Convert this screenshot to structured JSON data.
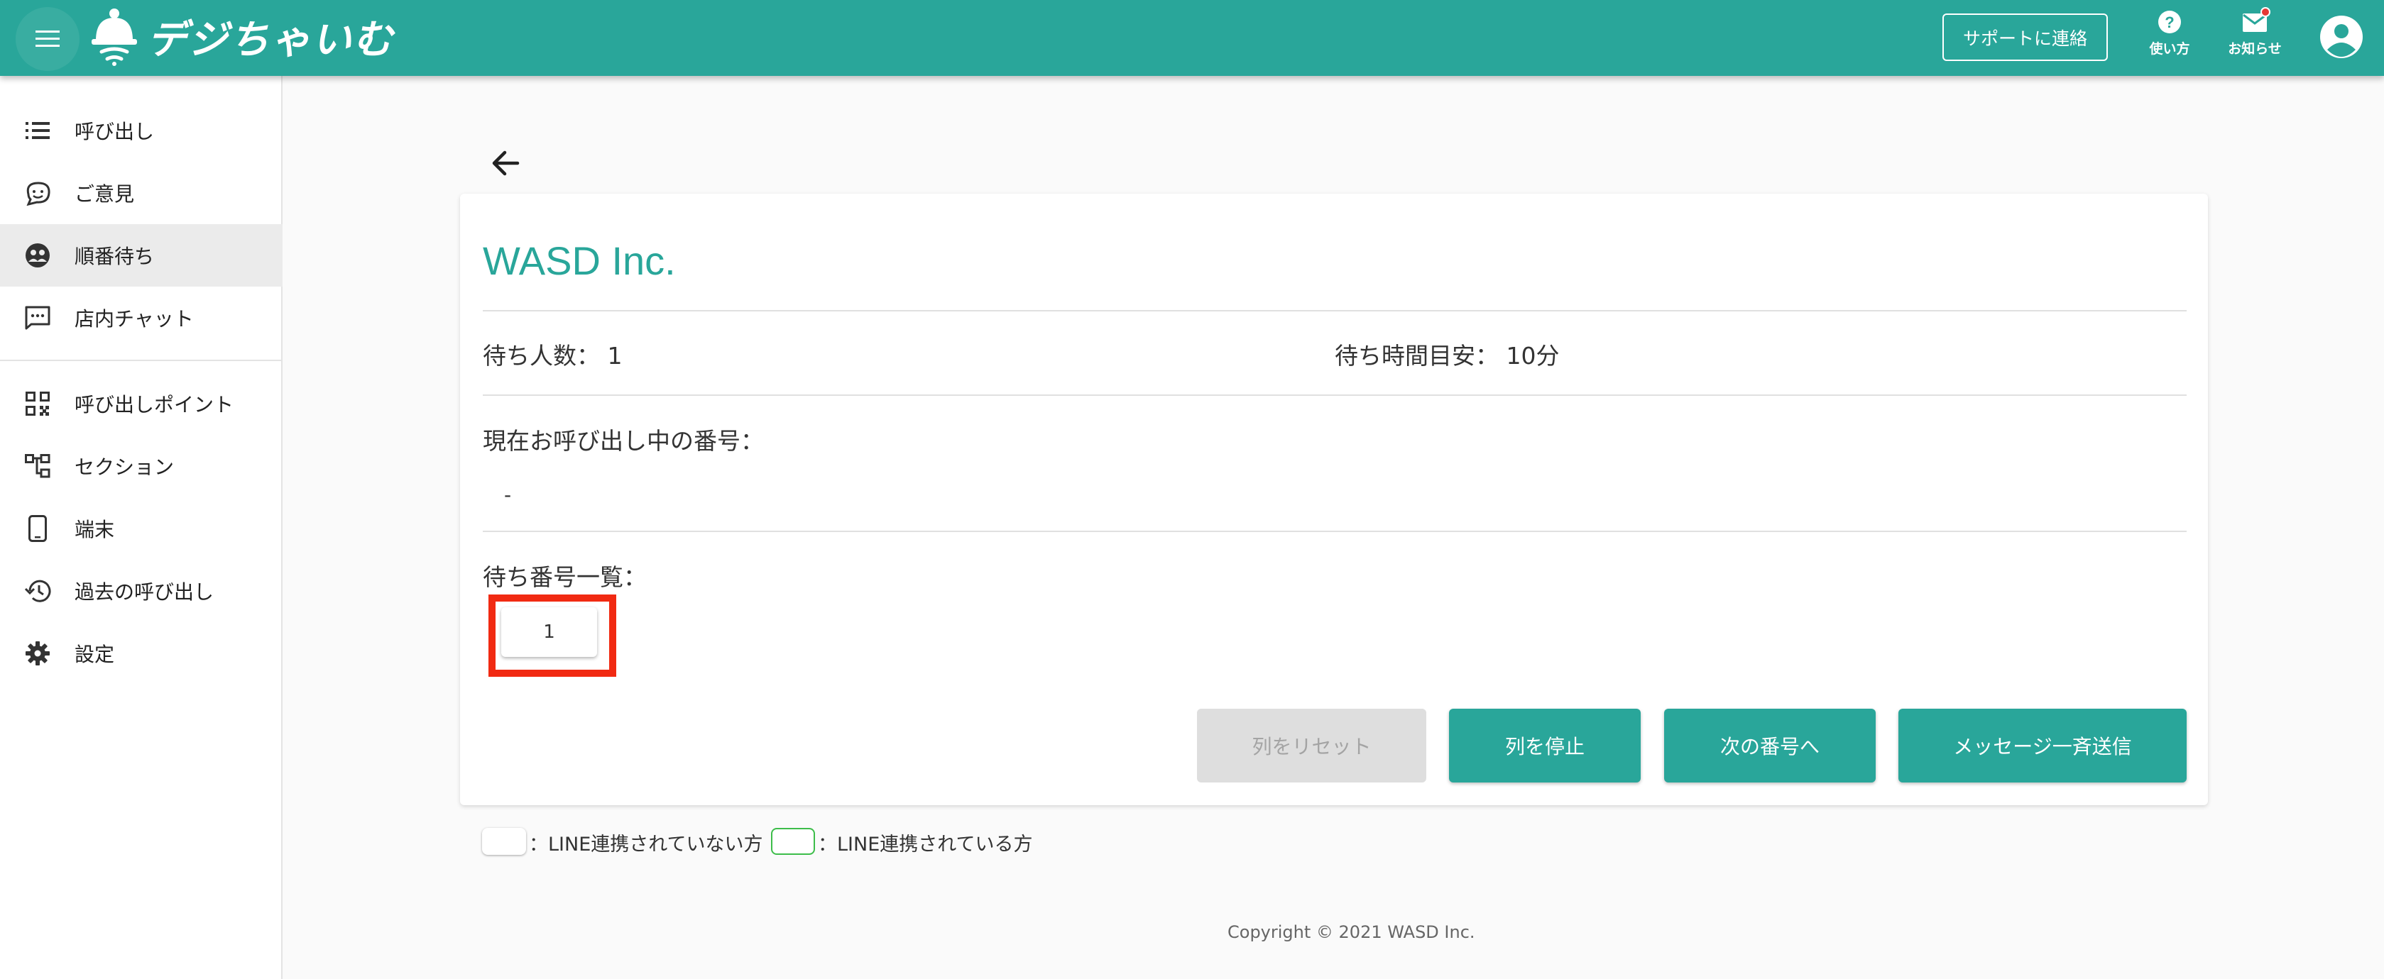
{
  "header": {
    "app_name": "デジちゃいむ",
    "support_label": "サポートに連絡",
    "help_label": "使い方",
    "notice_label": "お知らせ",
    "icons": [
      "menu-icon",
      "bell-logo-icon",
      "help-icon",
      "mail-icon",
      "account-icon"
    ],
    "color": "#29a69a"
  },
  "sidebar": {
    "items": [
      {
        "label": "呼び出し",
        "icon": "list-icon"
      },
      {
        "label": "ご意見",
        "icon": "feedback-icon"
      },
      {
        "label": "順番待ち",
        "icon": "queue-icon",
        "active": true
      },
      {
        "label": "店内チャット",
        "icon": "chat-icon"
      },
      {
        "label": "呼び出しポイント",
        "icon": "qr-code-icon"
      },
      {
        "label": "セクション",
        "icon": "section-icon"
      },
      {
        "label": "端末",
        "icon": "phone-icon"
      },
      {
        "label": "過去の呼び出し",
        "icon": "history-icon"
      },
      {
        "label": "設定",
        "icon": "gear-icon"
      }
    ]
  },
  "main": {
    "store_name": "WASD Inc.",
    "waiting_count_label": "待ち人数：",
    "waiting_count": "1",
    "wait_time_label": "待ち時間目安：",
    "wait_time": "10分",
    "current_number_label": "現在お呼び出し中の番号：",
    "current_number": "-",
    "waiting_list_label": "待ち番号一覧：",
    "waiting_numbers": [
      "1"
    ],
    "buttons": {
      "reset": "列をリセット",
      "stop": "列を停止",
      "next": "次の番号へ",
      "broadcast": "メッセージ一斉送信"
    }
  },
  "legend": {
    "not_linked": "：LINE連携されていない方",
    "linked": "：LINE連携されている方",
    "linked_color": "#3dbd4a"
  },
  "footer": {
    "copyright": "Copyright © 2021 WASD Inc."
  }
}
